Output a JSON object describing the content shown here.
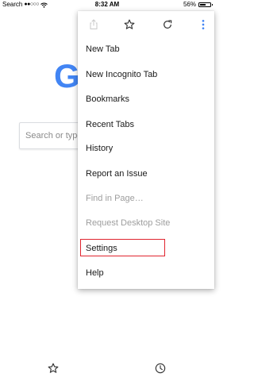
{
  "status_bar": {
    "carrier": "Search",
    "signal": "●●○○○",
    "time": "8:32 AM",
    "battery_text": "56%",
    "battery_level": 0.56
  },
  "page": {
    "logo_letter": "G",
    "search_placeholder": "Search or type"
  },
  "menu": {
    "toolbar_icons": [
      "share-icon",
      "star-icon",
      "reload-icon",
      "more-vertical-icon"
    ],
    "items": [
      {
        "label": "New Tab",
        "enabled": true
      },
      {
        "label": "New Incognito Tab",
        "enabled": true
      },
      {
        "label": "Bookmarks",
        "enabled": true
      },
      {
        "label": "Recent Tabs",
        "enabled": true
      },
      {
        "label": "History",
        "enabled": true
      },
      {
        "label": "Report an Issue",
        "enabled": true
      },
      {
        "label": "Find in Page…",
        "enabled": false
      },
      {
        "label": "Request Desktop Site",
        "enabled": false
      },
      {
        "label": "Settings",
        "enabled": true,
        "highlighted": true
      },
      {
        "label": "Help",
        "enabled": true
      }
    ]
  },
  "bottom_bar": {
    "icons": [
      "star-outline-icon",
      "clock-icon"
    ]
  },
  "colors": {
    "accent_blue": "#4285f4",
    "highlight_red": "#e0242f",
    "disabled_text": "#9e9e9e"
  }
}
